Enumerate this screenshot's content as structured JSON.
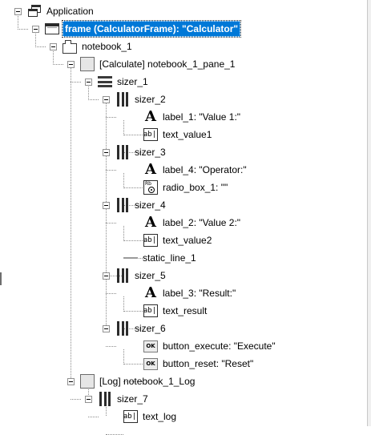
{
  "tree": {
    "nodes": [
      {
        "id": "app",
        "label": "Application",
        "icon": "app-window-icon"
      },
      {
        "id": "frame",
        "label": "frame (CalculatorFrame): \"Calculator\"",
        "icon": "frame-icon",
        "selected": true
      },
      {
        "id": "notebook_1",
        "label": "notebook_1",
        "icon": "notebook-icon"
      },
      {
        "id": "pane_1",
        "label": "[Calculate] notebook_1_pane_1",
        "icon": "panel-icon"
      },
      {
        "id": "sizer_1",
        "label": "sizer_1",
        "icon": "vertical-sizer-icon"
      },
      {
        "id": "sizer_2",
        "label": "sizer_2",
        "icon": "horizontal-sizer-icon"
      },
      {
        "id": "label_1",
        "label": "label_1: \"Value 1:\"",
        "icon": "static-text-icon"
      },
      {
        "id": "text_value1",
        "label": "text_value1",
        "icon": "text-ctrl-icon"
      },
      {
        "id": "sizer_3",
        "label": "sizer_3",
        "icon": "horizontal-sizer-icon"
      },
      {
        "id": "label_4",
        "label": "label_4: \"Operator:\"",
        "icon": "static-text-icon"
      },
      {
        "id": "radio_box_1",
        "label": "radio_box_1: \"\"",
        "icon": "radio-box-icon"
      },
      {
        "id": "sizer_4",
        "label": "sizer_4",
        "icon": "horizontal-sizer-icon"
      },
      {
        "id": "label_2",
        "label": "label_2: \"Value 2:\"",
        "icon": "static-text-icon"
      },
      {
        "id": "text_value2",
        "label": "text_value2",
        "icon": "text-ctrl-icon"
      },
      {
        "id": "static_line_1",
        "label": "static_line_1",
        "icon": "static-line-icon"
      },
      {
        "id": "sizer_5",
        "label": "sizer_5",
        "icon": "horizontal-sizer-icon"
      },
      {
        "id": "label_3",
        "label": "label_3: \"Result:\"",
        "icon": "static-text-icon"
      },
      {
        "id": "text_result",
        "label": "text_result",
        "icon": "text-ctrl-icon"
      },
      {
        "id": "sizer_6",
        "label": "sizer_6",
        "icon": "horizontal-sizer-icon"
      },
      {
        "id": "button_execute",
        "label": "button_execute: \"Execute\"",
        "icon": "button-icon"
      },
      {
        "id": "button_reset",
        "label": "button_reset: \"Reset\"",
        "icon": "button-icon"
      },
      {
        "id": "log_pane",
        "label": "[Log] notebook_1_Log",
        "icon": "panel-icon"
      },
      {
        "id": "sizer_7",
        "label": "sizer_7",
        "icon": "horizontal-sizer-icon"
      },
      {
        "id": "text_log",
        "label": "text_log",
        "icon": "text-ctrl-icon"
      }
    ],
    "icon_glyphs": {
      "text_ctrl": "ab|",
      "button": "OK",
      "static_text": "A",
      "radio_box": "Rb"
    },
    "colors": {
      "selection": "#0078d7",
      "selection_text": "#ffffff"
    }
  }
}
